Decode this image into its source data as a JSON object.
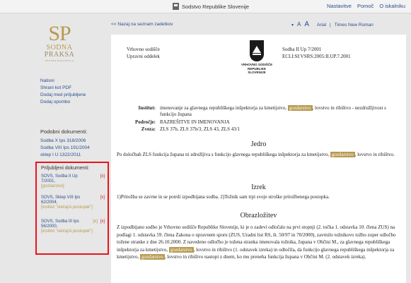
{
  "topbar": {
    "site_name": "Sodstvo Republike Slovenije",
    "links": [
      "Nastavitve",
      "Pomoč",
      "O iskalniku"
    ]
  },
  "brand": {
    "letters": "SP",
    "line1": "SODNA",
    "line2": "PRAKSA",
    "tagline": "TESTNA RAZLIČICA"
  },
  "actions": [
    "Natisni",
    "Shrani kot PDF",
    "Dodaj med priljubljene",
    "Dodaj opombo"
  ],
  "similar": {
    "title": "Podobni dokumenti:",
    "items": [
      "Sodba X Ips 318/2006",
      "Sodba VIII Ips 191/2004",
      "sklep I U 1322/2011"
    ]
  },
  "attached": {
    "title": "Priljubljeni dokumenti:",
    "items": [
      {
        "text": "SOVS, Sodba II Up 7/2001,",
        "tag": "[gozdarstvo]",
        "remove": "[x]",
        "edit": ""
      },
      {
        "text": "SOVS, Sklep VIII Ips 62/2004,",
        "tag": "[institut \"stečajni postopek\"]",
        "remove": "[x]",
        "edit": ""
      },
      {
        "text": "SOVS, Sodba III Ips 56/2000,",
        "tag": "[institut \"stečajni postopek\"]",
        "remove": "[x]",
        "edit": "[e]"
      }
    ]
  },
  "main": {
    "back": "<< Nazaj na seznam zadetkov",
    "font_controls": {
      "arrow": "▾",
      "small_a": "A",
      "big_a": "A",
      "font1": "Arial",
      "sep": "|",
      "font2": "Times New Roman"
    }
  },
  "doc": {
    "court": [
      "Vrhovno sodišče",
      "Upravni oddelek"
    ],
    "crest_text": [
      "VRHOVNO SODIŠČE",
      "REPUBLIKE SLOVENIJE"
    ],
    "ref": [
      "Sodba II Up 7/2001",
      "ECLI:SI:VSRS:2005:II.UP.7.2001"
    ],
    "institut_label": "Institut:",
    "institut_pre": "imenovanje za glavnega republiškega inšpektorja za kmetijstvo,",
    "institut_hl": "gozdarstvo",
    "institut_post": ", lovstvo in ribištvo - nezdružljivost s funkcijo župana",
    "podrocje_label": "Področje:",
    "podrocje": "RAZREŠITVE IN IMENOVANJA",
    "zveza_label": "Zveza:",
    "zveza": "ZLS 37b, ZLS 37b/3, ZLS 43, ZLS 43/1",
    "jedro_title": "Jedro",
    "jedro_pre": "Po določbah ZLS funkcija župana ni združljiva s funkcijo glavnega republiškega inšpektorja za kmetijstvo,",
    "jedro_hl": "gozdarstvo",
    "jedro_post": ", lovstvo in ribištvo.",
    "izrek_title": "Izrek",
    "izrek": "1)Pritožba se zavrne in se potrdi izpodbijana sodba. 2)Tožnik sam trpi svoje stroške pritožbenega postopka.",
    "obr_title": "Obrazložitev",
    "obr_1": "Z izpodbijano sodbo je Vrhovno sodišče Republike Slovenije, ki je o zadevi odločalo na prvi stopnji (2. točka 1. odstavka 10. člena ZUS) na podlagi 1. odstavka 59. člena Zakona o upravnem sporu (ZUS, Uradni list RS, št. 50/97 in 70/2000), zavrnilo tožnikovo tožbo zoper odločbo tožene stranke z dne 26.10.2000. Z navedeno odločbo je tožena stranka imenovala tožnika, župana v Občini M., za glavnega republiškega inšpektorja za kmetijstvo,",
    "obr_hl1": "gozdarstvo",
    "obr_2": ", lovstvo in ribištvo (1. odstavek izreka) in odločila, da funkcijo glavnega republiškega inšpektorja za kmetijstvo,",
    "obr_hl2": "gozdarstvo",
    "obr_3": ", lovstvo in ribištvo nastopi z dnem, ko mu preneha funkcija župana v Občini M. (2. odstavek izreka)."
  },
  "colors": {
    "accent": "#b79a50",
    "link": "#2b4e8f",
    "highlight_box": "#e8141c"
  }
}
